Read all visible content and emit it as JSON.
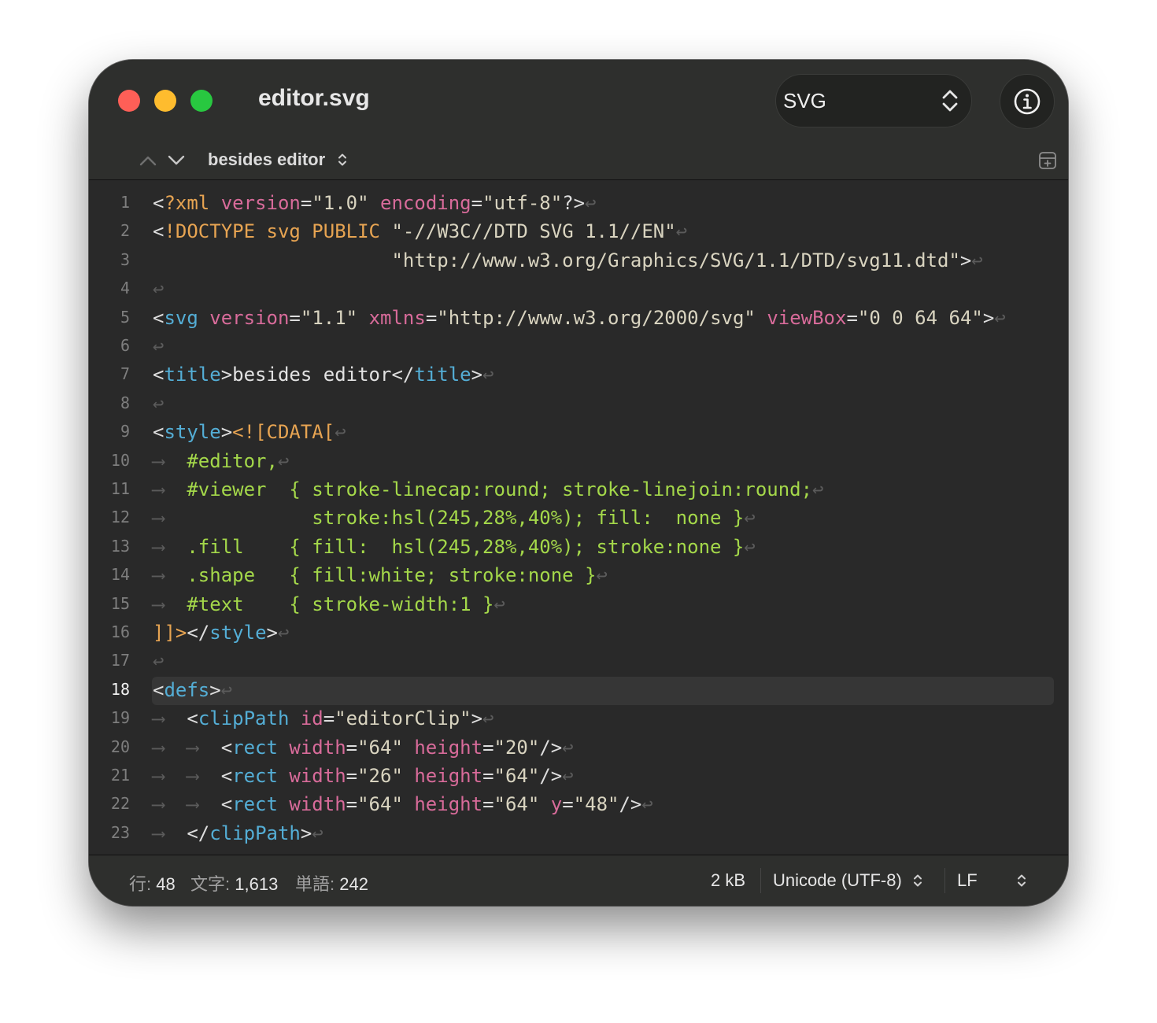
{
  "window": {
    "title": "editor.svg"
  },
  "toolbar": {
    "syntax_label": "SVG"
  },
  "navigation": {
    "outline_label": "besides editor"
  },
  "editor": {
    "current_line": 18,
    "lines": [
      {
        "n": "1",
        "tokens": [
          [
            "br",
            "<"
          ],
          [
            "key",
            "?xml"
          ],
          [
            "sp",
            " "
          ],
          [
            "attr",
            "version"
          ],
          [
            "br",
            "="
          ],
          [
            "str",
            "\"1.0\""
          ],
          [
            "sp",
            " "
          ],
          [
            "attr",
            "encoding"
          ],
          [
            "br",
            "="
          ],
          [
            "str",
            "\"utf-8\""
          ],
          [
            "br",
            "?>"
          ],
          [
            "inv",
            "↩"
          ]
        ]
      },
      {
        "n": "2",
        "tokens": [
          [
            "br",
            "<"
          ],
          [
            "key",
            "!DOCTYPE svg PUBLIC"
          ],
          [
            "sp",
            " "
          ],
          [
            "str",
            "\"-//W3C//DTD SVG 1.1//EN\""
          ],
          [
            "inv",
            "↩"
          ]
        ]
      },
      {
        "n": "3",
        "tokens": [
          [
            "sp",
            "                     "
          ],
          [
            "str",
            "\"http://www.w3.org/Graphics/SVG/1.1/DTD/svg11.dtd\""
          ],
          [
            "br",
            ">"
          ],
          [
            "inv",
            "↩"
          ]
        ]
      },
      {
        "n": "4",
        "tokens": [
          [
            "inv",
            "↩"
          ]
        ]
      },
      {
        "n": "5",
        "tokens": [
          [
            "br",
            "<"
          ],
          [
            "tag",
            "svg"
          ],
          [
            "sp",
            " "
          ],
          [
            "attr",
            "version"
          ],
          [
            "br",
            "="
          ],
          [
            "str",
            "\"1.1\""
          ],
          [
            "sp",
            " "
          ],
          [
            "attr",
            "xmlns"
          ],
          [
            "br",
            "="
          ],
          [
            "str",
            "\"http://www.w3.org/2000/svg\""
          ],
          [
            "sp",
            " "
          ],
          [
            "attr",
            "viewBox"
          ],
          [
            "br",
            "="
          ],
          [
            "str",
            "\"0 0 64 64\""
          ],
          [
            "br",
            ">"
          ],
          [
            "inv",
            "↩"
          ]
        ]
      },
      {
        "n": "6",
        "tokens": [
          [
            "inv",
            "↩"
          ]
        ]
      },
      {
        "n": "7",
        "tokens": [
          [
            "br",
            "<"
          ],
          [
            "tag",
            "title"
          ],
          [
            "br",
            ">"
          ],
          [
            "text",
            "besides editor"
          ],
          [
            "br",
            "</"
          ],
          [
            "tag",
            "title"
          ],
          [
            "br",
            ">"
          ],
          [
            "inv",
            "↩"
          ]
        ]
      },
      {
        "n": "8",
        "tokens": [
          [
            "inv",
            "↩"
          ]
        ]
      },
      {
        "n": "9",
        "tokens": [
          [
            "br",
            "<"
          ],
          [
            "tag",
            "style"
          ],
          [
            "br",
            ">"
          ],
          [
            "key",
            "<![CDATA["
          ],
          [
            "inv",
            "↩"
          ]
        ]
      },
      {
        "n": "10",
        "tokens": [
          [
            "inv",
            "⟶  "
          ],
          [
            "css",
            "#editor,"
          ],
          [
            "inv",
            "↩"
          ]
        ]
      },
      {
        "n": "11",
        "tokens": [
          [
            "inv",
            "⟶  "
          ],
          [
            "css",
            "#viewer  { stroke-linecap:round; stroke-linejoin:round;"
          ],
          [
            "inv",
            "↩"
          ]
        ]
      },
      {
        "n": "12",
        "tokens": [
          [
            "inv",
            "⟶  "
          ],
          [
            "css",
            "           stroke:hsl(245,28%,40%); fill:  none }"
          ],
          [
            "inv",
            "↩"
          ]
        ]
      },
      {
        "n": "13",
        "tokens": [
          [
            "inv",
            "⟶  "
          ],
          [
            "css",
            ".fill    { fill:  hsl(245,28%,40%); stroke:none }"
          ],
          [
            "inv",
            "↩"
          ]
        ]
      },
      {
        "n": "14",
        "tokens": [
          [
            "inv",
            "⟶  "
          ],
          [
            "css",
            ".shape   { fill:white; stroke:none }"
          ],
          [
            "inv",
            "↩"
          ]
        ]
      },
      {
        "n": "15",
        "tokens": [
          [
            "inv",
            "⟶  "
          ],
          [
            "css",
            "#text    { stroke-width:1 }"
          ],
          [
            "inv",
            "↩"
          ]
        ]
      },
      {
        "n": "16",
        "tokens": [
          [
            "key",
            "]]>"
          ],
          [
            "br",
            "</"
          ],
          [
            "tag",
            "style"
          ],
          [
            "br",
            ">"
          ],
          [
            "inv",
            "↩"
          ]
        ]
      },
      {
        "n": "17",
        "tokens": [
          [
            "inv",
            "↩"
          ]
        ]
      },
      {
        "n": "18",
        "tokens": [
          [
            "br",
            "<"
          ],
          [
            "tag",
            "defs"
          ],
          [
            "br",
            ">"
          ],
          [
            "inv",
            "↩"
          ]
        ]
      },
      {
        "n": "19",
        "tokens": [
          [
            "inv",
            "⟶  "
          ],
          [
            "br",
            "<"
          ],
          [
            "tag",
            "clipPath"
          ],
          [
            "sp",
            " "
          ],
          [
            "attr",
            "id"
          ],
          [
            "br",
            "="
          ],
          [
            "str",
            "\"editorClip\""
          ],
          [
            "br",
            ">"
          ],
          [
            "inv",
            "↩"
          ]
        ]
      },
      {
        "n": "20",
        "tokens": [
          [
            "inv",
            "⟶  ⟶  "
          ],
          [
            "br",
            "<"
          ],
          [
            "tag",
            "rect"
          ],
          [
            "sp",
            " "
          ],
          [
            "attr",
            "width"
          ],
          [
            "br",
            "="
          ],
          [
            "str",
            "\"64\""
          ],
          [
            "sp",
            " "
          ],
          [
            "attr",
            "height"
          ],
          [
            "br",
            "="
          ],
          [
            "str",
            "\"20\""
          ],
          [
            "br",
            "/>"
          ],
          [
            "inv",
            "↩"
          ]
        ]
      },
      {
        "n": "21",
        "tokens": [
          [
            "inv",
            "⟶  ⟶  "
          ],
          [
            "br",
            "<"
          ],
          [
            "tag",
            "rect"
          ],
          [
            "sp",
            " "
          ],
          [
            "attr",
            "width"
          ],
          [
            "br",
            "="
          ],
          [
            "str",
            "\"26\""
          ],
          [
            "sp",
            " "
          ],
          [
            "attr",
            "height"
          ],
          [
            "br",
            "="
          ],
          [
            "str",
            "\"64\""
          ],
          [
            "br",
            "/>"
          ],
          [
            "inv",
            "↩"
          ]
        ]
      },
      {
        "n": "22",
        "tokens": [
          [
            "inv",
            "⟶  ⟶  "
          ],
          [
            "br",
            "<"
          ],
          [
            "tag",
            "rect"
          ],
          [
            "sp",
            " "
          ],
          [
            "attr",
            "width"
          ],
          [
            "br",
            "="
          ],
          [
            "str",
            "\"64\""
          ],
          [
            "sp",
            " "
          ],
          [
            "attr",
            "height"
          ],
          [
            "br",
            "="
          ],
          [
            "str",
            "\"64\""
          ],
          [
            "sp",
            " "
          ],
          [
            "attr",
            "y"
          ],
          [
            "br",
            "="
          ],
          [
            "str",
            "\"48\""
          ],
          [
            "br",
            "/>"
          ],
          [
            "inv",
            "↩"
          ]
        ]
      },
      {
        "n": "23",
        "tokens": [
          [
            "inv",
            "⟶  "
          ],
          [
            "br",
            "</"
          ],
          [
            "tag",
            "clipPath"
          ],
          [
            "br",
            ">"
          ],
          [
            "inv",
            "↩"
          ]
        ]
      }
    ]
  },
  "status": {
    "line_label": "行:",
    "line_value": "48",
    "chars_label": "文字:",
    "chars_value": "1,613",
    "words_label": "単語:",
    "words_value": "242",
    "file_size": "2 kB",
    "encoding": "Unicode (UTF-8)",
    "line_ending": "LF"
  },
  "icons": {
    "close": "red-dot",
    "minimize": "yellow-dot",
    "zoom": "green-dot",
    "syntax_chevrons": "chevron-up-down-icon",
    "info": "info-icon",
    "previous": "chevron-up-icon",
    "next": "chevron-down-icon",
    "split": "split-view-icon"
  },
  "colors": {
    "window_bg": "#2a2a2a",
    "titlebar_bg": "#2e2f2d",
    "close": "#fe5f57",
    "minimize": "#febc2e",
    "zoom": "#28c840",
    "tag": "#54aed6",
    "attribute": "#d86b9a",
    "keyword": "#e7a452",
    "css": "#a4d84a",
    "string": "#d9d4c0",
    "invisibles": "#5b5b5b"
  }
}
